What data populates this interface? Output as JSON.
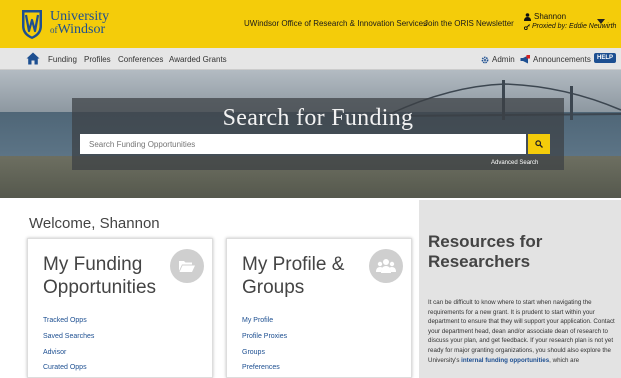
{
  "brand": {
    "university_line1": "University",
    "university_line2_prefix": "of",
    "university_line2": "Windsor",
    "primary_color": "#f4cc0a",
    "brand_blue": "#1d4f91"
  },
  "topbar": {
    "oris_link": "UWindsor Office of Research & Innovation Services",
    "newsletter_link": "Join the ORIS Newsletter",
    "user_name": "Shannon",
    "proxy_text": "Proxied by: Eddie Neuwirth"
  },
  "nav": {
    "items": [
      "Funding",
      "Profiles",
      "Conferences",
      "Awarded Grants"
    ],
    "admin": "Admin",
    "announcements": "Announcements",
    "help": "HELP"
  },
  "hero": {
    "title": "Search for Funding",
    "search_placeholder": "Search Funding Opportunities",
    "advanced_search": "Advanced Search"
  },
  "welcome": "Welcome, Shannon",
  "cards": {
    "funding": {
      "title_line1": "My Funding",
      "title_line2": "Opportunities",
      "links": [
        "Tracked Opps",
        "Saved Searches",
        "Advisor",
        "Curated Opps"
      ]
    },
    "profile": {
      "title_line1": "My Profile &",
      "title_line2": "Groups",
      "links": [
        "My Profile",
        "Profile Proxies",
        "Groups",
        "Preferences"
      ]
    }
  },
  "resources": {
    "title_line1": "Resources for",
    "title_line2": "Researchers",
    "body_main": "It can be difficult to know where to start when navigating the requirements for a new grant. It is prudent to start within your department to ensure that they will support your application. Contact your department head, dean and/or associate dean of research to discuss your plan, and get feedback. If your research plan is not yet ready for major granting organizations, you should also explore the University's ",
    "body_link": "internal funding opportunities",
    "body_tail": ", which are"
  }
}
